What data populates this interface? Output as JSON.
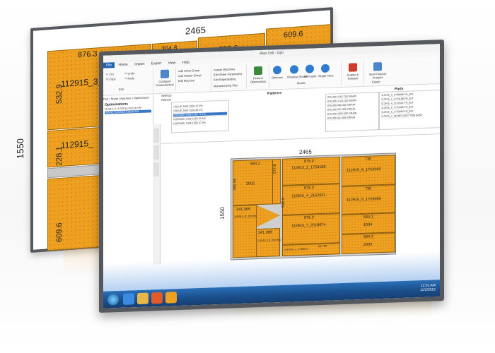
{
  "back_window": {
    "width_label": "2465",
    "height_label": "1550",
    "panels": {
      "p1_label": "112915_3_1786880",
      "p1_top": "876.3",
      "p1_side": "532.9",
      "p2_top": "304.8",
      "p3_top": "609.6",
      "p4_top": "609.6",
      "p5_label": "112915_",
      "p5_side": "228.1",
      "p6_side": "609.6"
    }
  },
  "front_window": {
    "title": "Blue Cell - Opti",
    "ribbon_tabs": [
      "File",
      "Home",
      "Import",
      "Export",
      "View",
      "Help"
    ],
    "ribbon_buttons": {
      "configure": "Configure Productionline",
      "add_items": "Add Items Group",
      "add_master": "Add Master Group",
      "edit_machine": "Edit Machine",
      "assign_machines": "Assign Machines",
      "edit_sheet": "Edit Sheet Parameters",
      "edit_edgebanding": "Edit Edgebanding",
      "perform_optimization": "Perform Optimization",
      "optimize": "Optimize",
      "windows_rotate": "Windows Rotate",
      "fp_import": "FP Import",
      "single_parts": "Single Parts",
      "optimize2": "Optimize",
      "submit": "Submit & Release",
      "send_export": "Send Polyexit Analysis"
    },
    "ribbon_group_labels": [
      "Edit",
      "Manufacturing Plan",
      "Modes",
      "Export"
    ],
    "left_panel": {
      "tabs": [
        "Part",
        "Sheet",
        "Machine",
        "Optimization"
      ],
      "section": "Optimizations",
      "item1": "112915_3 11/2/2016 8:55:00 PM",
      "item2": "Optimiz 11/2/2016 8:55:00 PM"
    },
    "grids": {
      "patterns_title": "Patterns",
      "parts_title": "Parts",
      "settings_label": "Settings",
      "reports_label": "Reports",
      "left_rows": [
        "1  BLUE  2465  1550  47.9%",
        "2  BLUE  2465  1550  68.3%",
        "3  BROWN  2465  1550  71.1%",
        "4  BROWN  2465  1550  62.6%",
        "5  BROWN  2465  1550  47.0%"
      ],
      "mid_rows": [
        "876.300  1162.700  GRAIN",
        "876.300  1144.100  GRAIN",
        "876.300  980.400  GRAIN",
        "876.300  932.900  GRAIN",
        "876.300  1054.500  GRAIN",
        "876.300  941.600  GRAIN"
      ],
      "right_rows": [
        "112915_3_1786880  FH_BLT",
        "112915_2_1754188  FH_BLT",
        "112915_4_2152621  FH_BLT",
        "112915_5_1753086  FH_BLT",
        "112915_6_1753084  FH_BLT",
        "112915_7_2518674  BOTTOM BASE"
      ]
    },
    "canvas": {
      "width_label": "2465",
      "height_label": "1550",
      "labels": {
        "a": "584.2",
        "b": "2002",
        "c": "181.55",
        "d": "277.8",
        "e": "879.4",
        "f": "112915_2_1754188",
        "g": "876.3",
        "h": "112915_4_2152621",
        "i": "532.9",
        "j": "876.3",
        "k": "112915_7_2518674",
        "l": "730",
        "m": "112915_6_1753099",
        "n": "730",
        "o": "112915_5_1753099",
        "p": "584.3",
        "q": "1004",
        "r": "584.3",
        "s": "2003",
        "t": "341.099",
        "u": "112915_8_2018657",
        "v": "341.099",
        "w": "112915_10_2018557",
        "x": "112915_9",
        "y": "517.00",
        "z": "1004",
        "aa": "1112915_1_1780672"
      }
    },
    "taskbar": {
      "time": "12:01 AM",
      "date": "11/2/2016"
    }
  }
}
